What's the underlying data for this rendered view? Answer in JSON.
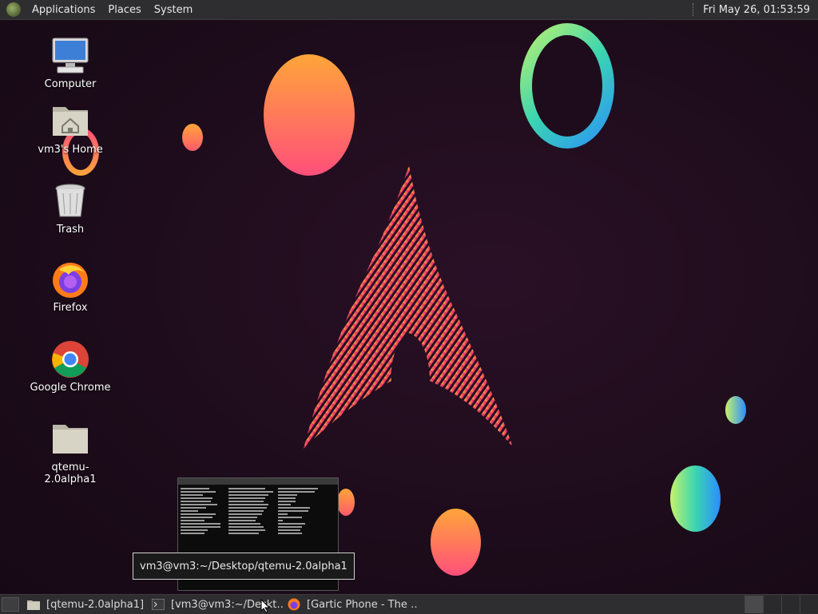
{
  "top_panel": {
    "menus": [
      "Applications",
      "Places",
      "System"
    ],
    "clock": "Fri May 26, 01:53:59"
  },
  "desktop_icons": [
    {
      "label": "Computer",
      "icon": "computer-icon"
    },
    {
      "label": "vm3's Home",
      "icon": "home-folder-icon"
    },
    {
      "label": "Trash",
      "icon": "trash-icon"
    },
    {
      "label": "Firefox",
      "icon": "firefox-icon"
    },
    {
      "label": "Google Chrome",
      "icon": "chrome-icon"
    },
    {
      "label": "qtemu-2.0alpha1",
      "icon": "folder-icon"
    }
  ],
  "tooltip": "vm3@vm3:~/Desktop/qtemu-2.0alpha1",
  "taskbar": {
    "tasks": [
      {
        "label": "[qtemu-2.0alpha1]",
        "icon": "folder-icon"
      },
      {
        "label": "[vm3@vm3:~/Deskt…",
        "icon": "terminal-icon"
      },
      {
        "label": "[Gartic Phone - The …",
        "icon": "firefox-icon"
      }
    ]
  }
}
